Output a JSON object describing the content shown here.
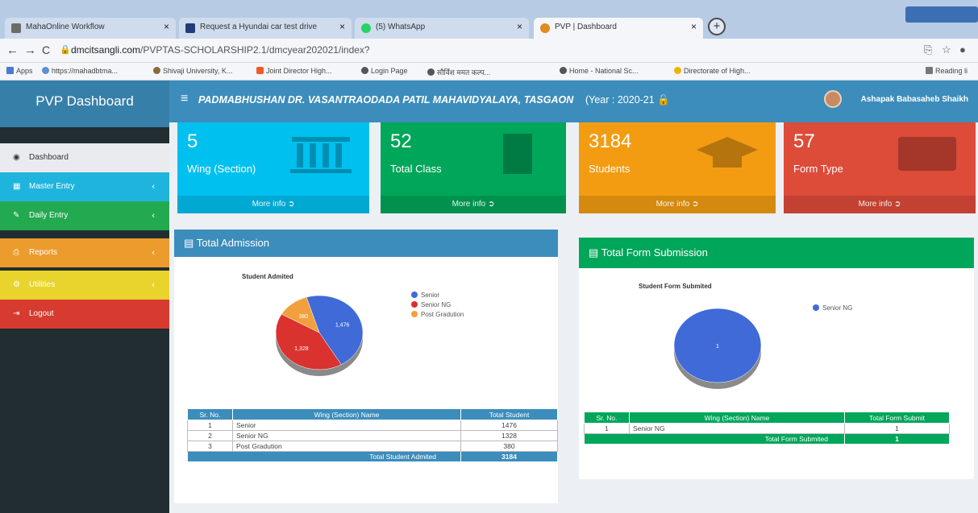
{
  "browser": {
    "tabs": [
      {
        "title": "MahaOnline Workflow",
        "icon_color": "#6b6b6b"
      },
      {
        "title": "Request a Hyundai car test drive",
        "icon_color": "#223d7a"
      },
      {
        "title": "(5) WhatsApp",
        "icon_color": "#25d366"
      },
      {
        "title": "PVP | Dashboard",
        "icon_color": "#e08a1f"
      }
    ],
    "url_domain": "dmcitsangli.com",
    "url_path": "/PVPTAS-SCHOLARSHIP2.1/dmcyear202021/index?",
    "bookmarks": [
      "Apps",
      "https://mahadbtma...",
      "Shivaji University, K...",
      "Joint Director High...",
      "Login Page",
      "सौर्विश ममत कल्प...",
      "Home - National Sc...",
      "Directorate of High...",
      "Reading li"
    ]
  },
  "sidebar": {
    "brand": "PVP Dashboard",
    "items": [
      {
        "label": "Dashboard",
        "icon": "dashboard-icon",
        "color": "#e9ebee"
      },
      {
        "label": "Master Entry",
        "icon": "table-icon",
        "color": "#1fb4dd"
      },
      {
        "label": "Daily Entry",
        "icon": "edit-icon",
        "color": "#23a94f"
      },
      {
        "label": "Reports",
        "icon": "print-icon",
        "color": "#ec9b2d"
      },
      {
        "label": "Utilities",
        "icon": "cogs-icon",
        "color": "#e8d42c"
      },
      {
        "label": "Logout",
        "icon": "sign-out-icon",
        "color": "#d73a2f"
      }
    ]
  },
  "header": {
    "college": "PADMABHUSHAN DR. VASANTRAODADA PATIL MAHAVIDYALAYA, TASGAON",
    "year": "(Year : 2020-21",
    "user": "Ashapak Babasaheb Shaikh"
  },
  "cards": [
    {
      "value": "5",
      "label": "Wing (Section)",
      "more": "More info",
      "color": "#00c0ef"
    },
    {
      "value": "52",
      "label": "Total Class",
      "more": "More info",
      "color": "#00a65a"
    },
    {
      "value": "3184",
      "label": "Students",
      "more": "More info",
      "color": "#f39c12"
    },
    {
      "value": "57",
      "label": "Form Type",
      "more": "More info",
      "color": "#dd4b39"
    }
  ],
  "admission": {
    "title": "Total Admission",
    "chart_title": "Student Admited",
    "table_headers": [
      "Sr. No.",
      "Wing (Section) Name",
      "Total Student"
    ],
    "rows": [
      {
        "sr": "1",
        "name": "Senior",
        "total": "1476"
      },
      {
        "sr": "2",
        "name": "Senior NG",
        "total": "1328"
      },
      {
        "sr": "3",
        "name": "Post Gradution",
        "total": "380"
      }
    ],
    "footer_label": "Total Student Admited",
    "footer_value": "3184"
  },
  "submission": {
    "title": "Total Form Submission",
    "chart_title": "Student Form Submited",
    "table_headers": [
      "Sr. No.",
      "Wing (Section) Name",
      "Total Form Submit"
    ],
    "rows": [
      {
        "sr": "1",
        "name": "Senior NG",
        "total": "1"
      }
    ],
    "footer_label": "Total Form Submited",
    "footer_value": "1"
  },
  "chart_data": [
    {
      "type": "pie",
      "title": "Student Admited",
      "categories": [
        "Senior",
        "Senior NG",
        "Post Gradution"
      ],
      "values": [
        1476,
        1328,
        380
      ],
      "labels": [
        "1,476",
        "1,328",
        "380"
      ],
      "colors": [
        "#3f6ad8",
        "#d9322f",
        "#f2a03d"
      ],
      "legend": "right"
    },
    {
      "type": "pie",
      "title": "Student Form Submited",
      "categories": [
        "Senior NG"
      ],
      "values": [
        1
      ],
      "labels": [
        "1"
      ],
      "colors": [
        "#3f6ad8"
      ],
      "legend": "right"
    }
  ]
}
